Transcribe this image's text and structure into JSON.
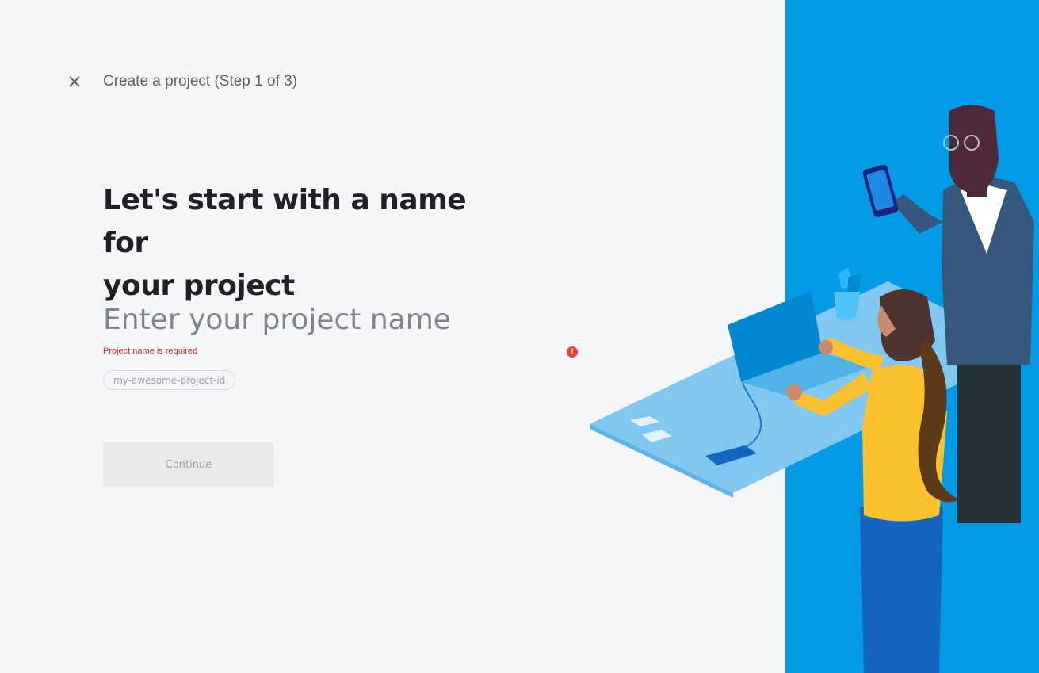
{
  "header": {
    "close_icon": "close-icon",
    "title": "Create a project (Step 1 of 3)"
  },
  "main": {
    "heading_line1": "Let's start with a name for",
    "heading_line2": "your project",
    "name_input": {
      "value": "",
      "placeholder": "Enter your project name"
    },
    "error_message": "Project name is required",
    "error_icon": "error-icon",
    "project_id_chip": "my-awesome-project-id",
    "continue_label": "Continue"
  },
  "colors": {
    "background": "#f5f6f8",
    "panel_blue": "#039be5",
    "error": "#d93025",
    "heading": "#202124"
  }
}
